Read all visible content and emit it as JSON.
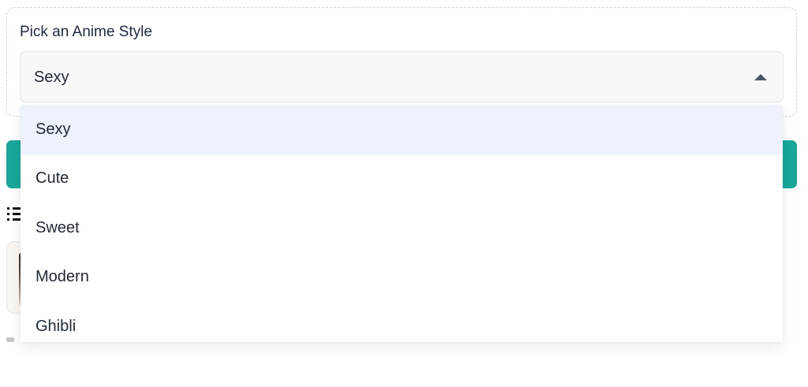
{
  "style_picker": {
    "label": "Pick an Anime Style",
    "selected_value": "Sexy",
    "options": [
      {
        "label": "Sexy",
        "selected": true
      },
      {
        "label": "Cute",
        "selected": false
      },
      {
        "label": "Sweet",
        "selected": false
      },
      {
        "label": "Modern",
        "selected": false
      },
      {
        "label": "Ghibli",
        "selected": false
      }
    ]
  },
  "colors": {
    "accent": "#19a79b",
    "selected_option_bg": "#edf2fc",
    "select_bg": "#f7f8fa"
  },
  "icons": {
    "caret": "caret-up-icon",
    "list": "list-icon"
  }
}
